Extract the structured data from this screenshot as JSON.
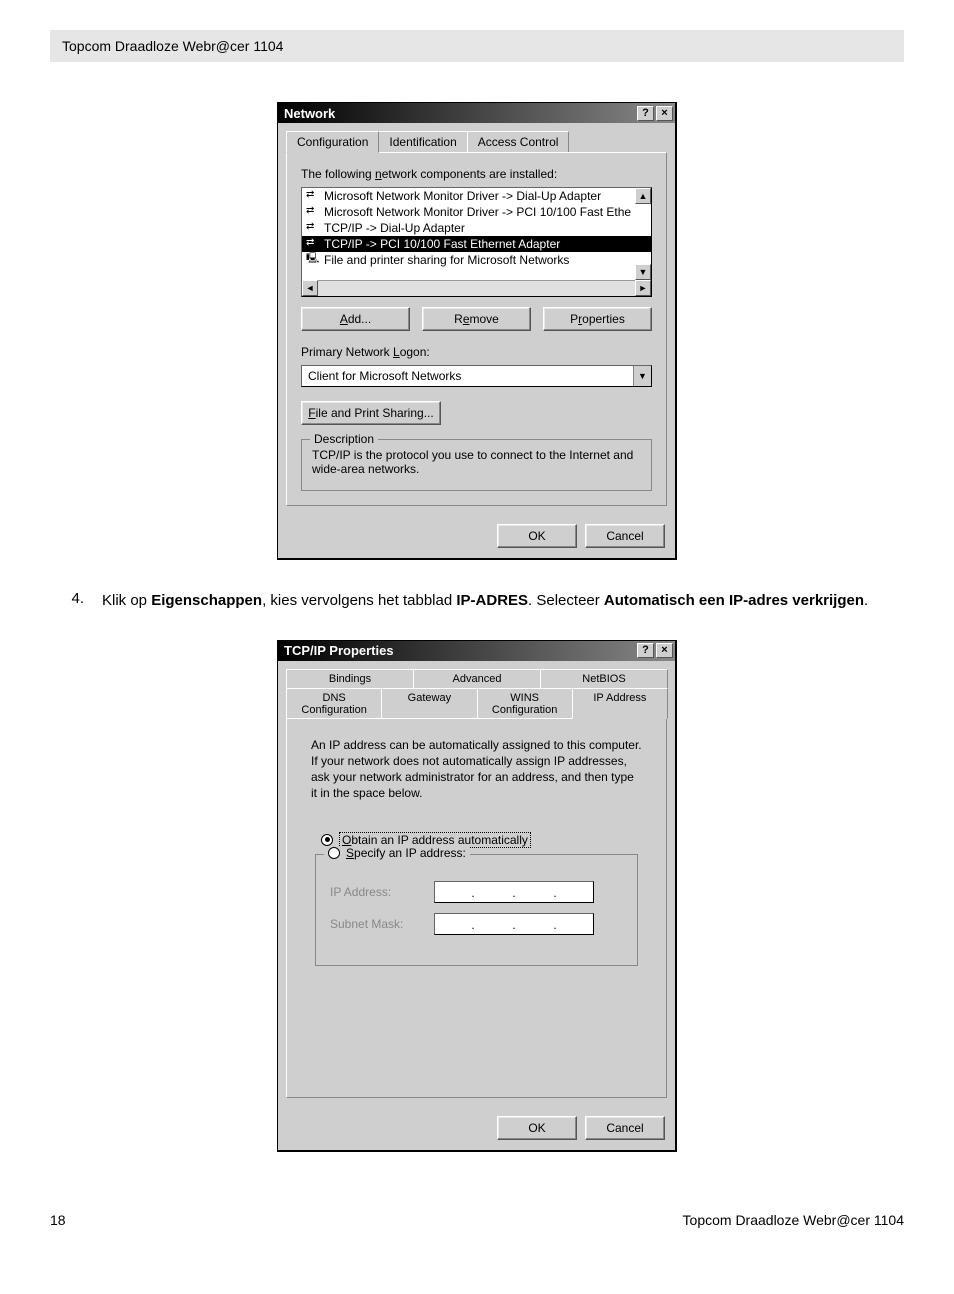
{
  "header": {
    "title": "Topcom Draadloze Webr@cer 1104"
  },
  "network_dialog": {
    "title": "Network",
    "tabs": [
      "Configuration",
      "Identification",
      "Access Control"
    ],
    "components_label": "The following network components are installed:",
    "list_items": [
      "Microsoft Network Monitor Driver -> Dial-Up Adapter",
      "Microsoft Network Monitor Driver -> PCI 10/100 Fast Ethe",
      "TCP/IP -> Dial-Up Adapter",
      "TCP/IP -> PCI 10/100 Fast Ethernet Adapter",
      "File and printer sharing for Microsoft Networks"
    ],
    "buttons": {
      "add": "Add...",
      "remove": "Remove",
      "properties": "Properties"
    },
    "logon_label": "Primary Network Logon:",
    "logon_value": "Client for Microsoft Networks",
    "file_print": "File and Print Sharing...",
    "desc_legend": "Description",
    "desc_text": "TCP/IP is the protocol you use to connect to the Internet and wide-area networks.",
    "ok": "OK",
    "cancel": "Cancel"
  },
  "instruction": {
    "num": "4.",
    "pre": "Klik op ",
    "b1": "Eigenschappen",
    "mid1": ", kies vervolgens het tabblad ",
    "b2": "IP-ADRES",
    "mid2": ". Selecteer ",
    "b3": "Automatisch een IP-adres verkrijgen",
    "post": "."
  },
  "tcpip_dialog": {
    "title": "TCP/IP Properties",
    "tabs_row1": [
      "Bindings",
      "Advanced",
      "NetBIOS"
    ],
    "tabs_row2": [
      "DNS Configuration",
      "Gateway",
      "WINS Configuration",
      "IP Address"
    ],
    "info": "An IP address can be automatically assigned to this computer. If your network does not automatically assign IP addresses, ask your network administrator for an address, and then type it in the space below.",
    "radio_auto": "Obtain an IP address automatically",
    "radio_specify": "Specify an IP address:",
    "ip_label": "IP Address:",
    "mask_label": "Subnet Mask:",
    "ok": "OK",
    "cancel": "Cancel"
  },
  "footer": {
    "page": "18",
    "title": "Topcom Draadloze Webr@cer 1104"
  }
}
